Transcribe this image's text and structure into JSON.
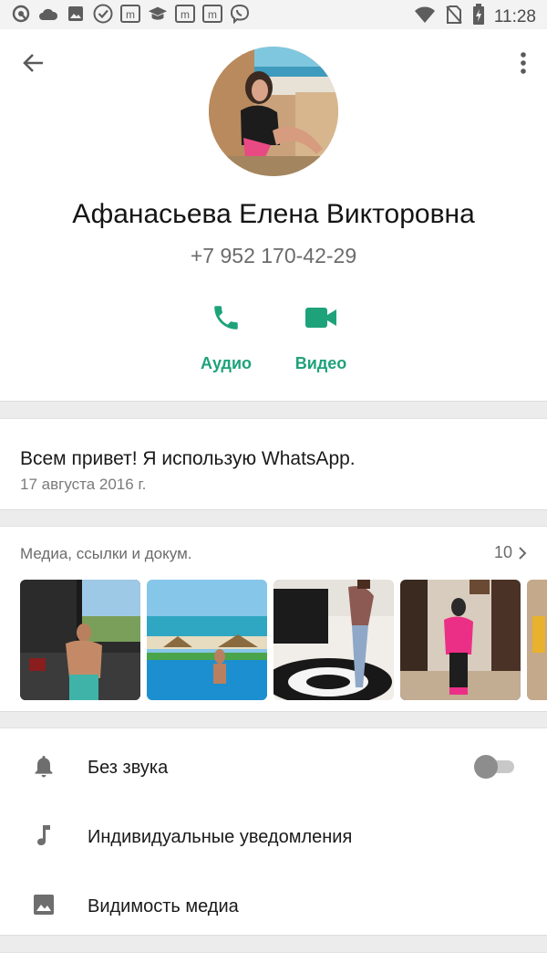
{
  "status_bar": {
    "time": "11:28",
    "notification_icons": [
      "quora-icon",
      "cloud-icon",
      "image-icon",
      "check-circle-icon",
      "m-app-icon",
      "graduation-cap-icon",
      "m-app-icon",
      "m-app-icon",
      "viber-icon"
    ],
    "right_icons": [
      "wifi-icon",
      "no-sim-icon",
      "battery-charging-icon"
    ]
  },
  "contact": {
    "name": "Афанасьева Елена Викторовна",
    "phone": "+7 952 170-42-29"
  },
  "actions": [
    {
      "label": "Аудио",
      "icon": "phone-icon"
    },
    {
      "label": "Видео",
      "icon": "video-camera-icon"
    }
  ],
  "about": {
    "text": "Всем привет! Я использую WhatsApp.",
    "date": "17 августа 2016 г."
  },
  "media": {
    "title": "Медиа, ссылки и докум.",
    "count": "10",
    "thumbnails": [
      "gym-photo",
      "beach-pool-photo",
      "kitchen-photo",
      "mirror-selfie-photo",
      "partial-photo"
    ]
  },
  "settings": [
    {
      "label": "Без звука",
      "icon": "bell-icon",
      "toggle": false
    },
    {
      "label": "Индивидуальные уведомления",
      "icon": "music-note-icon"
    },
    {
      "label": "Видимость медиа",
      "icon": "image-icon"
    }
  ],
  "colors": {
    "accent": "#00a884",
    "action_label": "#1ea27a",
    "background": "#ececec"
  }
}
